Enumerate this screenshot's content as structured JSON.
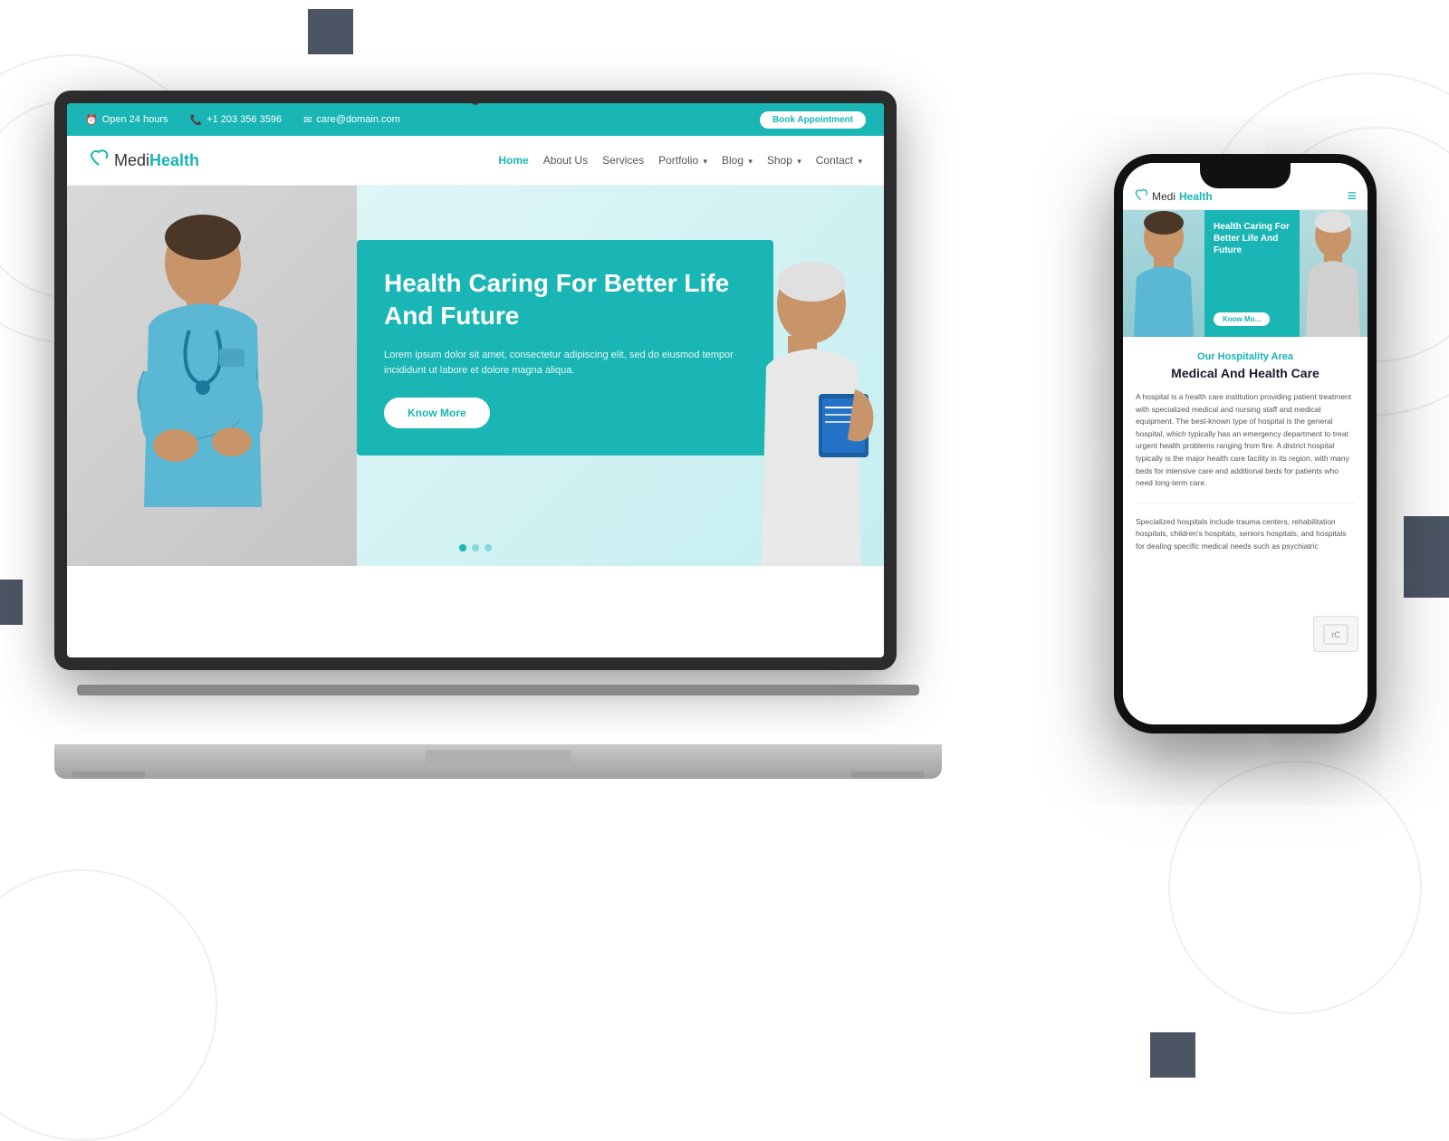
{
  "page": {
    "background_color": "#ffffff"
  },
  "decorative": {
    "squares": [
      "top-left",
      "mid-right",
      "mid-left",
      "bottom-right"
    ]
  },
  "laptop": {
    "topbar": {
      "open_hours": "Open 24 hours",
      "phone": "+1 203 356 3596",
      "email": "care@domain.com",
      "book_btn": "Book Appointment"
    },
    "navbar": {
      "logo_medi": "Medi",
      "logo_health": "Health",
      "links": [
        {
          "label": "Home",
          "active": true
        },
        {
          "label": "About Us",
          "active": false
        },
        {
          "label": "Services",
          "active": false
        },
        {
          "label": "Portfolio",
          "active": false,
          "has_arrow": true
        },
        {
          "label": "Blog",
          "active": false,
          "has_arrow": true
        },
        {
          "label": "Shop",
          "active": false,
          "has_arrow": true
        },
        {
          "label": "Contact",
          "active": false,
          "has_arrow": true
        }
      ]
    },
    "hero": {
      "title": "Health Caring For Better Life And Future",
      "description": "Lorem ipsum dolor sit amet, consectetur adipiscing elit, sed do eiusmod tempor incididunt ut labore et dolore magna aliqua.",
      "cta_button": "Know More",
      "dots": [
        true,
        false,
        false
      ]
    }
  },
  "phone": {
    "logo_medi": "Medi",
    "logo_health": "Health",
    "menu_icon": "≡",
    "hero": {
      "title": "Health Caring For Better Life And Future",
      "know_more": "Know Mo..."
    },
    "hospitality": {
      "subtitle": "Our Hospitality Area",
      "main_title": "Medical And Health Care",
      "text1": "A hospital is a health care institution providing patient treatment with specialized medical and nursing staff and medical equipment. The best-known type of hospital is the general hospital, which typically has an emergency department to treat urgent health problems ranging from fire. A district hospital typically is the major health care facility in its region, with many beds for intensive care and additional beds for patients who need long-term care.",
      "text2": "Specialized hospitals include trauma centers, rehabilitation hospitals, children's hospitals, seniors hospitals, and hospitals for dealing specific medical needs such as psychiatric"
    }
  }
}
